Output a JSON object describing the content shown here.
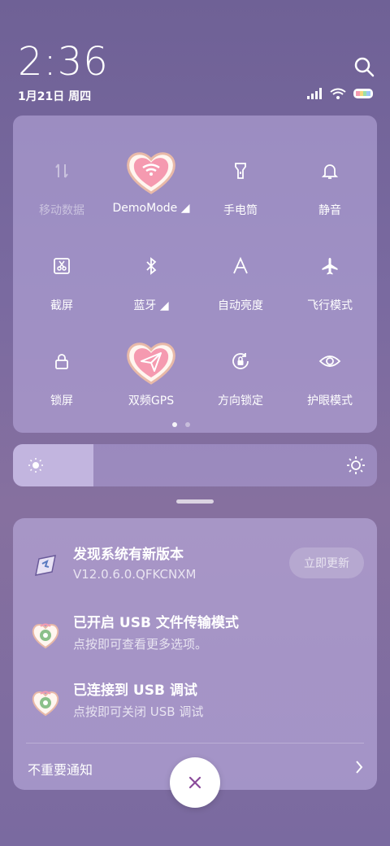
{
  "status": {
    "time": "2:36",
    "date": "1月21日 周四"
  },
  "tiles": [
    {
      "label": "移动数据",
      "icon": "mobile-data-icon"
    },
    {
      "label": "DemoMode",
      "icon": "wifi-heart-icon"
    },
    {
      "label": "手电筒",
      "icon": "flashlight-icon"
    },
    {
      "label": "静音",
      "icon": "bell-icon"
    },
    {
      "label": "截屏",
      "icon": "screenshot-icon"
    },
    {
      "label": "蓝牙",
      "icon": "bluetooth-icon"
    },
    {
      "label": "自动亮度",
      "icon": "auto-brightness-icon"
    },
    {
      "label": "飞行模式",
      "icon": "airplane-icon"
    },
    {
      "label": "锁屏",
      "icon": "lock-icon"
    },
    {
      "label": "双频GPS",
      "icon": "gps-heart-icon"
    },
    {
      "label": "方向锁定",
      "icon": "rotation-lock-icon"
    },
    {
      "label": "护眼模式",
      "icon": "eye-icon"
    }
  ],
  "brightness": {
    "level": 0.22
  },
  "notifications": [
    {
      "title": "发现系统有新版本",
      "subtitle": "V12.0.6.0.QFKCNXM",
      "action": "立即更新",
      "icon": "update-icon"
    },
    {
      "title": "已开启 USB 文件传输模式",
      "subtitle": "点按即可查看更多选项。",
      "icon": "usb-icon"
    },
    {
      "title": "已连接到 USB 调试",
      "subtitle": "点按即可关闭 USB 调试",
      "icon": "usb-debug-icon"
    }
  ],
  "footer": {
    "minor_label": "不重要通知"
  },
  "colors": {
    "accent": "#8a4a9a",
    "heart": "#f59ab0"
  }
}
